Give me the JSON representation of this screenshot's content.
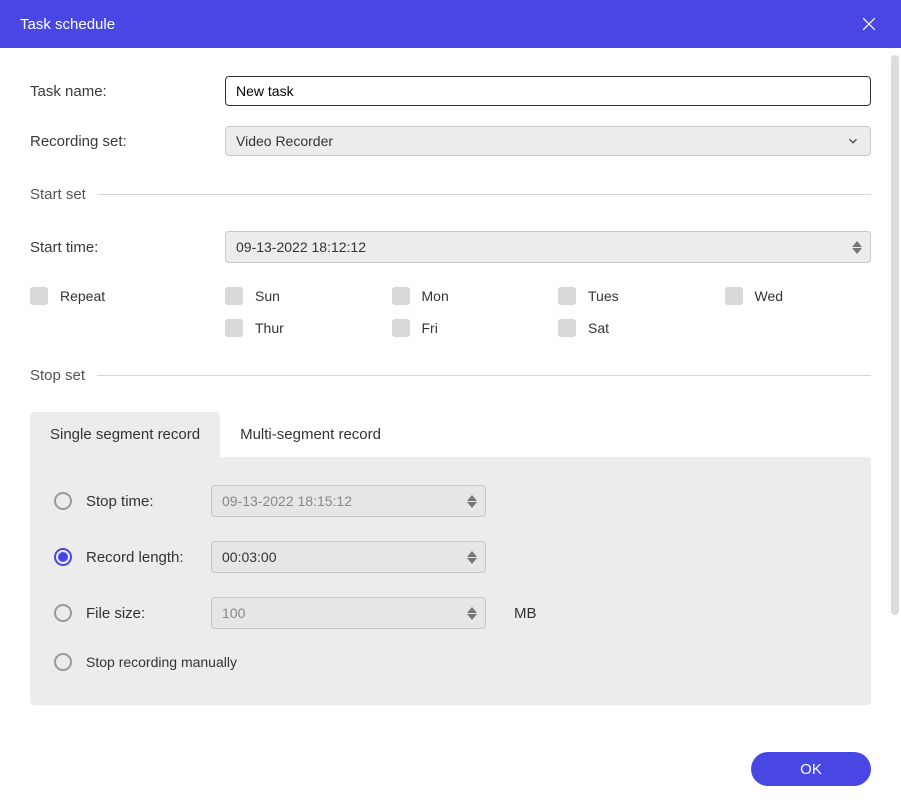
{
  "title": "Task schedule",
  "labels": {
    "task_name": "Task name:",
    "recording_set": "Recording set:",
    "start_set": "Start set",
    "start_time": "Start time:",
    "repeat": "Repeat",
    "stop_set": "Stop set"
  },
  "task_name_value": "New task",
  "recording_set_value": "Video Recorder",
  "start_time_value": "09-13-2022 18:12:12",
  "days": {
    "sun": "Sun",
    "mon": "Mon",
    "tues": "Tues",
    "wed": "Wed",
    "thur": "Thur",
    "fri": "Fri",
    "sat": "Sat"
  },
  "tabs": {
    "single": "Single segment record",
    "multi": "Multi-segment record"
  },
  "stop_options": {
    "stop_time_label": "Stop time:",
    "stop_time_value": "09-13-2022 18:15:12",
    "record_length_label": "Record length:",
    "record_length_value": "00:03:00",
    "file_size_label": "File size:",
    "file_size_value": "100",
    "file_size_unit": "MB",
    "manual_label": "Stop recording manually"
  },
  "ok": "OK"
}
